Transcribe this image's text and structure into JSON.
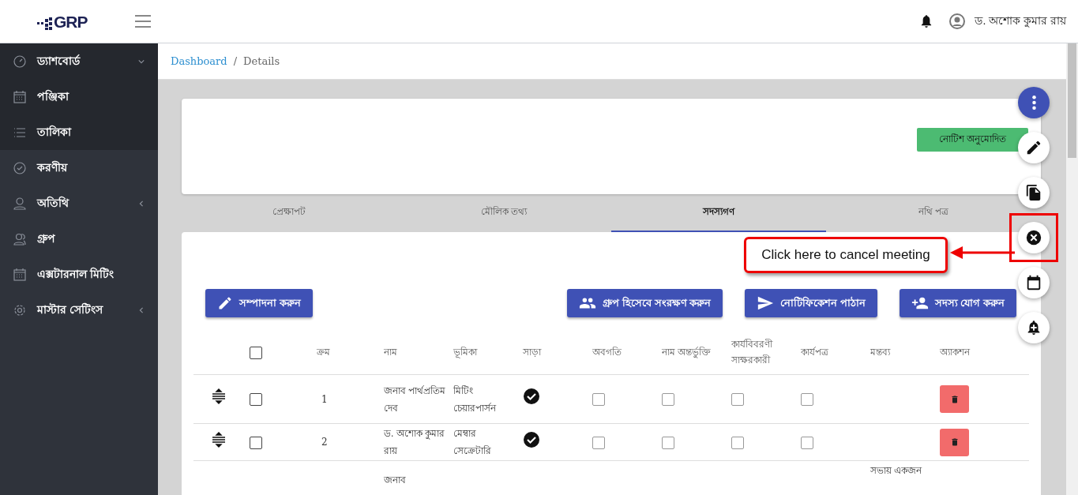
{
  "header": {
    "logo": "GRP",
    "user_name": "ড. অশোক কুমার রায়"
  },
  "sidebar": {
    "items": [
      {
        "label": "ড্যাশবোর্ড",
        "kind": "group",
        "expanded": true,
        "children": [
          {
            "label": "পঞ্জিকা",
            "selected": false
          },
          {
            "label": "তালিকা",
            "selected": false
          }
        ]
      },
      {
        "label": "করণীয়",
        "kind": "link"
      },
      {
        "label": "অতিথি",
        "kind": "group",
        "expanded": false
      },
      {
        "label": "গ্রুপ",
        "kind": "link"
      },
      {
        "label": "এক্সটারনাল মিটিং",
        "kind": "link"
      },
      {
        "label": "মাস্টার সেটিংস",
        "kind": "group",
        "expanded": false
      }
    ]
  },
  "breadcrumb": {
    "separator": "/",
    "items": [
      "Dashboard",
      "Details"
    ]
  },
  "status_badge": "নোটিশ অনুমোদিত",
  "tabs": [
    {
      "label": "প্রেক্ষাপট",
      "selected": false
    },
    {
      "label": "মৌলিক তথ্য",
      "selected": false
    },
    {
      "label": "সদস্যগণ",
      "selected": true
    },
    {
      "label": "নথি পত্র",
      "selected": false
    }
  ],
  "actions": {
    "edit": "সম্পাদনা করুন",
    "save_group": "গ্রুপ হিসেবে সংরক্ষণ করুন",
    "send_notification": "নোটিফিকেশন পাঠান",
    "add_member": "সদস্য যোগ করুন"
  },
  "table": {
    "select_all": false,
    "columns": [
      "ক্রম",
      "নাম",
      "ভূমিকা",
      "সাড়া",
      "অবগতি",
      "নাম অন্তর্ভুক্তি",
      "কার্যবিবরণী সাক্ষরকারী",
      "কার্যপত্র",
      "মন্তব্য",
      "অ্যাকশন"
    ],
    "rows": [
      {
        "selected": false,
        "serial": "1",
        "name": "জনাব পার্থপ্রতিম দেব",
        "role": "মিটিং চেয়ারপার্সন",
        "response": true,
        "informed": false,
        "included": false,
        "signer": false,
        "worksheet": false
      },
      {
        "selected": false,
        "serial": "2",
        "name": "ড. অশোক কুমার রায়",
        "role": "মেম্বার সেক্রেটারি",
        "response": true,
        "informed": false,
        "included": false,
        "signer": false,
        "worksheet": false
      },
      {
        "name": "জনাব",
        "comment": "সভায় একজন"
      }
    ]
  },
  "callout": "Click here to cancel meeting"
}
